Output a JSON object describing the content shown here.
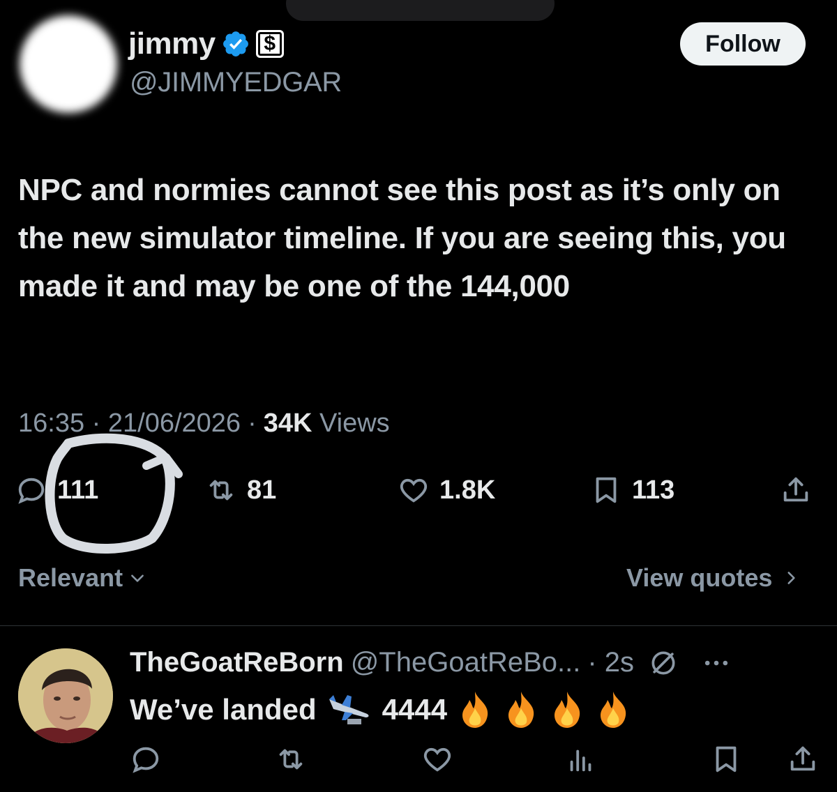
{
  "post": {
    "author": {
      "display_name": "jimmy",
      "handle": "@JIMMYEDGAR",
      "dollar_badge": "$"
    },
    "follow_label": "Follow",
    "text": "NPC and normies cannot see this post as it’s only on the new simulator timeline. If you are seeing this, you made it and may be one of the 144,000",
    "timestamp": "16:35 · 21/06/2026",
    "separator": "·",
    "views_count": "34K",
    "views_label": "Views",
    "stats": {
      "replies": "111",
      "reposts": "81",
      "likes": "1.8K",
      "bookmarks": "113"
    },
    "sort_label": "Relevant",
    "view_quotes_label": "View quotes"
  },
  "reply": {
    "display_name": "TheGoatReBorn",
    "handle": "@TheGoatReBo...",
    "time": "· 2s",
    "text": "We’ve landed",
    "number": "4444"
  },
  "colors": {
    "background": "#000000",
    "primary_text": "#e7e9ea",
    "secondary_text": "#8b98a5",
    "verified_blue": "#1d9bf0",
    "follow_bg": "#eff3f4"
  },
  "icons": [
    "verified-icon",
    "dollar-icon",
    "reply-icon",
    "repost-icon",
    "like-icon",
    "bookmark-icon",
    "share-icon",
    "chevron-down-icon",
    "chevron-right-icon",
    "grok-icon",
    "more-icon",
    "views-icon",
    "airplane-emoji",
    "fire-emoji"
  ]
}
